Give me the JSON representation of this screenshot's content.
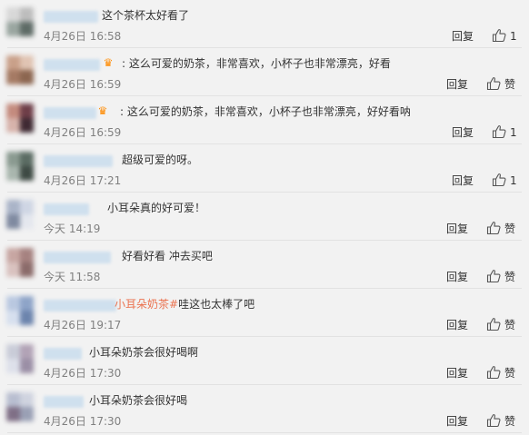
{
  "comments": [
    {
      "text_prefix": "",
      "text_hashtag": "",
      "text": "这个茶杯太好看了",
      "time": "4月26日 16:58",
      "reply": "回复",
      "like": "1"
    },
    {
      "text_prefix": "",
      "text_hashtag": "",
      "text": ": 这么可爱的奶茶，非常喜欢，小杯子也非常漂亮，好看",
      "time": "4月26日 16:59",
      "reply": "回复",
      "like": "赞"
    },
    {
      "text_prefix": "",
      "text_hashtag": "",
      "text": ": 这么可爱的奶茶，非常喜欢，小杯子也非常漂亮，好好看呐",
      "time": "4月26日 16:59",
      "reply": "回复",
      "like": "1"
    },
    {
      "text_prefix": "",
      "text_hashtag": "",
      "text": "超级可爱的呀。",
      "time": "4月26日 17:21",
      "reply": "回复",
      "like": "1"
    },
    {
      "text_prefix": "",
      "text_hashtag": "",
      "text": "小耳朵真的好可爱！",
      "time": "今天 14:19",
      "reply": "回复",
      "like": "赞"
    },
    {
      "text_prefix": "",
      "text_hashtag": "",
      "text": "好看好看 冲去买吧",
      "time": "今天 11:58",
      "reply": "回复",
      "like": "赞"
    },
    {
      "text_prefix": "",
      "text_hashtag": "小耳朵奶茶#",
      "text": "哇这也太棒了吧",
      "time": "4月26日 19:17",
      "reply": "回复",
      "like": "赞"
    },
    {
      "text_prefix": "",
      "text_hashtag": "",
      "text": "小耳朵奶茶会很好喝啊",
      "time": "4月26日 17:30",
      "reply": "回复",
      "like": "赞"
    },
    {
      "text_prefix": "",
      "text_hashtag": "",
      "text": "小耳朵奶茶会很好喝",
      "time": "4月26日 17:30",
      "reply": "回复",
      "like": "赞"
    }
  ],
  "icons": {
    "like": "thumbs-up-icon",
    "vip": "vip-badge-icon"
  },
  "colors": {
    "hashtag": "#eb7350",
    "timestamp": "#808080",
    "background": "#f2f2f2"
  }
}
